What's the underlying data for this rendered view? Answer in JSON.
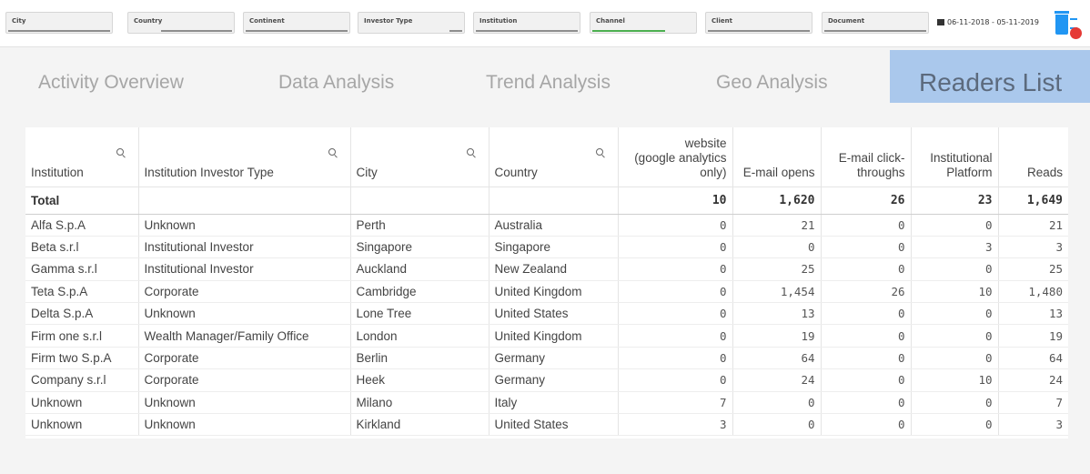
{
  "filters": [
    {
      "label": "City"
    },
    {
      "label": "Country"
    },
    {
      "label": "Continent"
    },
    {
      "label": "Investor Type"
    },
    {
      "label": "Institution"
    },
    {
      "label": "Channel"
    },
    {
      "label": "Client"
    },
    {
      "label": "Document"
    }
  ],
  "date_range": "06-11-2018 - 05-11-2019",
  "trash_badge": "",
  "tabs": [
    {
      "label": "Activity Overview"
    },
    {
      "label": "Data Analysis"
    },
    {
      "label": "Trend Analysis"
    },
    {
      "label": "Geo Analysis"
    },
    {
      "label": "Readers List"
    }
  ],
  "active_tab": "Readers List",
  "table": {
    "headers": [
      {
        "line1": "",
        "line2": "",
        "line3": "Institution"
      },
      {
        "line1": "",
        "line2": "",
        "line3": "Institution Investor Type"
      },
      {
        "line1": "",
        "line2": "",
        "line3": "City"
      },
      {
        "line1": "",
        "line2": "",
        "line3": "Country"
      },
      {
        "line1": "website",
        "line2": "(google analytics",
        "line3": "only)"
      },
      {
        "line1": "",
        "line2": "",
        "line3": "E-mail opens"
      },
      {
        "line1": "",
        "line2": "E-mail click-",
        "line3": "throughs"
      },
      {
        "line1": "",
        "line2": "Institutional",
        "line3": "Platform"
      },
      {
        "line1": "",
        "line2": "",
        "line3": "Reads"
      }
    ],
    "total": {
      "label": "Total",
      "website": "10",
      "opens": "1,620",
      "clicks": "26",
      "platform": "23",
      "reads": "1,649"
    },
    "rows": [
      {
        "institution": "Alfa S.p.A",
        "type": "Unknown",
        "city": "Perth",
        "country": "Australia",
        "website": "0",
        "opens": "21",
        "clicks": "0",
        "platform": "0",
        "reads": "21"
      },
      {
        "institution": "Beta s.r.l",
        "type": "Institutional Investor",
        "city": "Singapore",
        "country": "Singapore",
        "website": "0",
        "opens": "0",
        "clicks": "0",
        "platform": "3",
        "reads": "3"
      },
      {
        "institution": "Gamma s.r.l",
        "type": "Institutional Investor",
        "city": "Auckland",
        "country": "New Zealand",
        "website": "0",
        "opens": "25",
        "clicks": "0",
        "platform": "0",
        "reads": "25"
      },
      {
        "institution": "Teta S.p.A",
        "type": "Corporate",
        "city": "Cambridge",
        "country": "United Kingdom",
        "website": "0",
        "opens": "1,454",
        "clicks": "26",
        "platform": "10",
        "reads": "1,480"
      },
      {
        "institution": "Delta S.p.A",
        "type": "Unknown",
        "city": "Lone Tree",
        "country": "United States",
        "website": "0",
        "opens": "13",
        "clicks": "0",
        "platform": "0",
        "reads": "13"
      },
      {
        "institution": "Firm one s.r.l",
        "type": "Wealth Manager/Family Office",
        "city": "London",
        "country": "United Kingdom",
        "website": "0",
        "opens": "19",
        "clicks": "0",
        "platform": "0",
        "reads": "19"
      },
      {
        "institution": "Firm two S.p.A",
        "type": "Corporate",
        "city": "Berlin",
        "country": "Germany",
        "website": "0",
        "opens": "64",
        "clicks": "0",
        "platform": "0",
        "reads": "64"
      },
      {
        "institution": "Company s.r.l",
        "type": "Corporate",
        "city": "Heek",
        "country": "Germany",
        "website": "0",
        "opens": "24",
        "clicks": "0",
        "platform": "10",
        "reads": "24"
      },
      {
        "institution": "Unknown",
        "type": "Unknown",
        "city": "Milano",
        "country": "Italy",
        "website": "7",
        "opens": "0",
        "clicks": "0",
        "platform": "0",
        "reads": "7"
      },
      {
        "institution": "Unknown",
        "type": "Unknown",
        "city": "Kirkland",
        "country": "United States",
        "website": "3",
        "opens": "0",
        "clicks": "0",
        "platform": "0",
        "reads": "3"
      }
    ]
  },
  "colors": {
    "active_tab_bg": "#aac8ec",
    "trash_icon": "#2196f3",
    "badge": "#e53935",
    "channel_bar": "#4caf50"
  },
  "icons": {
    "search": "search-icon",
    "calendar": "calendar-icon",
    "trash": "trash-icon"
  }
}
